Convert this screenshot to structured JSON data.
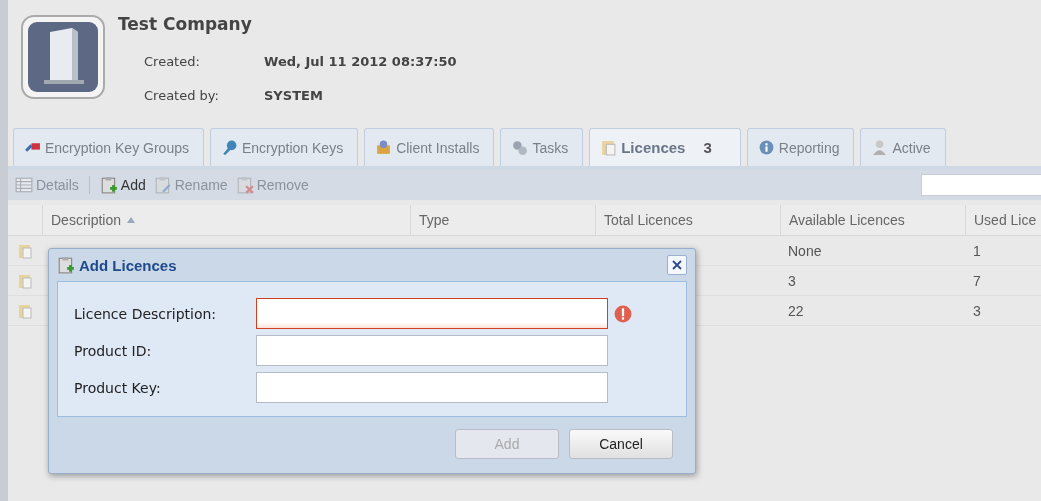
{
  "company": {
    "name": "Test Company",
    "fields": [
      {
        "label": "Created:",
        "value": "Wed, Jul 11 2012 08:37:50"
      },
      {
        "label": "Created by:",
        "value": "SYSTEM"
      }
    ]
  },
  "tabs": [
    {
      "label": "Encryption Key Groups",
      "selected": false
    },
    {
      "label": "Encryption Keys",
      "selected": false
    },
    {
      "label": "Client Installs",
      "selected": false
    },
    {
      "label": "Tasks",
      "selected": false
    },
    {
      "label": "Licences",
      "count": "3",
      "selected": true
    },
    {
      "label": "Reporting",
      "selected": false
    },
    {
      "label": "Active",
      "selected": false
    }
  ],
  "toolbar": [
    {
      "label": "Details",
      "disabled": true
    },
    {
      "label": "Add",
      "disabled": false
    },
    {
      "label": "Rename",
      "disabled": true
    },
    {
      "label": "Remove",
      "disabled": true
    }
  ],
  "table": {
    "columns": [
      {
        "label": "Description",
        "sorted": true
      },
      {
        "label": "Type"
      },
      {
        "label": "Total Licences"
      },
      {
        "label": "Available Licences"
      },
      {
        "label": "Used Lice"
      }
    ],
    "rows": [
      {
        "available": "None",
        "used": "1"
      },
      {
        "available": "3",
        "used": "7"
      },
      {
        "available": "22",
        "used": "3"
      }
    ]
  },
  "dialog": {
    "title": "Add Licences",
    "fields": [
      {
        "label": "Licence Description:",
        "invalid": true
      },
      {
        "label": "Product ID:",
        "invalid": false
      },
      {
        "label": "Product Key:",
        "invalid": false
      }
    ],
    "buttons": [
      {
        "label": "Add",
        "disabled": true
      },
      {
        "label": "Cancel",
        "disabled": false
      }
    ]
  }
}
